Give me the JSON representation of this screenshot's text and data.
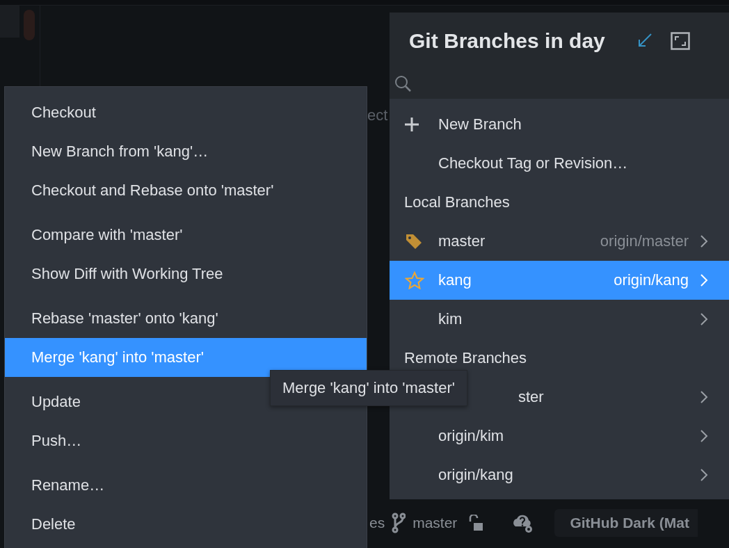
{
  "background": {
    "editor_text": "ect",
    "status_bar": {
      "partial_label": "es",
      "branch": "master",
      "theme": "GitHub Dark (Mat"
    }
  },
  "context_menu": {
    "groups": [
      [
        {
          "label": "Checkout",
          "selected": false
        },
        {
          "label": "New Branch from 'kang'…",
          "selected": false
        },
        {
          "label": "Checkout and Rebase onto 'master'",
          "selected": false
        }
      ],
      [
        {
          "label": "Compare with 'master'",
          "selected": false
        },
        {
          "label": "Show Diff with Working Tree",
          "selected": false
        }
      ],
      [
        {
          "label": "Rebase 'master' onto 'kang'",
          "selected": false
        },
        {
          "label": "Merge 'kang' into 'master'",
          "selected": true
        }
      ],
      [
        {
          "label": "Update",
          "selected": false
        },
        {
          "label": "Push…",
          "selected": false
        }
      ],
      [
        {
          "label": "Rename…",
          "selected": false
        },
        {
          "label": "Delete",
          "selected": false
        }
      ]
    ]
  },
  "tooltip": {
    "text": "Merge 'kang' into 'master'"
  },
  "branches_popup": {
    "title": "Git Branches in day",
    "actions": [
      {
        "label": "New Branch",
        "kind": "create"
      },
      {
        "label": "Checkout Tag or Revision…",
        "kind": "plain"
      }
    ],
    "sections": [
      {
        "heading": "Local Branches",
        "branches": [
          {
            "name": "master",
            "tracking": "origin/master",
            "kind": "tag",
            "selected": false
          },
          {
            "name": "kang",
            "tracking": "origin/kang",
            "kind": "star",
            "selected": true
          },
          {
            "name": "kim",
            "kind": "plain",
            "selected": false
          }
        ]
      },
      {
        "heading": "Remote Branches",
        "branches": [
          {
            "name": "ster",
            "kind": "covered",
            "selected": false
          },
          {
            "name": "origin/kim",
            "kind": "plain",
            "selected": false
          },
          {
            "name": "origin/kang",
            "kind": "plain",
            "selected": false
          }
        ]
      }
    ]
  }
}
